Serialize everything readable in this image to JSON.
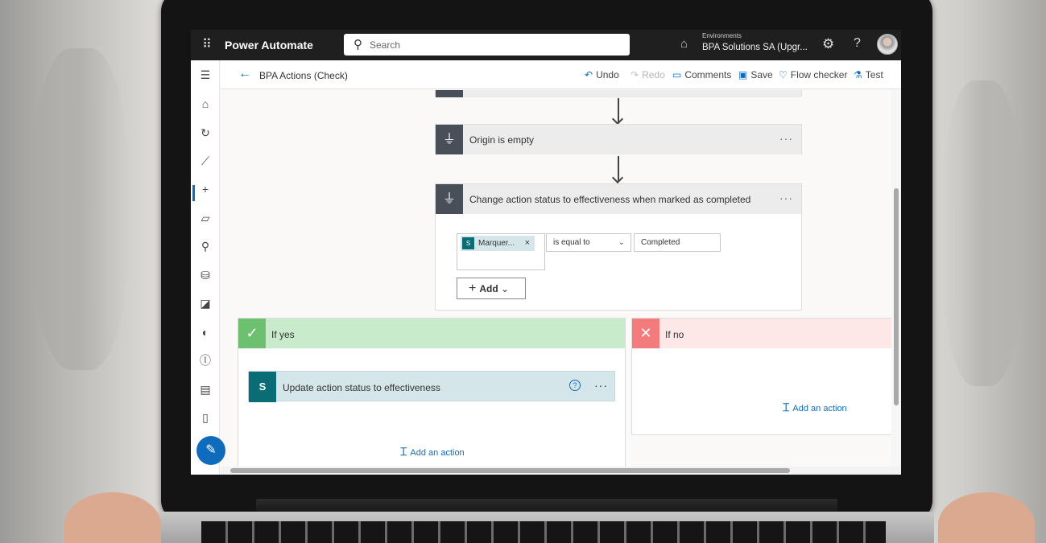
{
  "app": {
    "name": "Power Automate",
    "waffle_icon": "⠿"
  },
  "search": {
    "placeholder": "Search"
  },
  "environment": {
    "label": "Environments",
    "value": "BPA Solutions SA (Upgr..."
  },
  "header_icons": {
    "settings": "⚙",
    "help": "?"
  },
  "flow": {
    "title": "BPA Actions (Check)"
  },
  "commands": {
    "undo": "Undo",
    "redo": "Redo",
    "comments": "Comments",
    "save": "Save",
    "flow_checker": "Flow checker",
    "test": "Test"
  },
  "nav_icons": [
    "☰",
    "⌂",
    "↻",
    "⟋",
    "+",
    "▱",
    "⚲",
    "⛁",
    "◪",
    "◐",
    "ⓛ",
    "▤",
    "▯"
  ],
  "steps": {
    "origin": {
      "title": "Origin is empty"
    },
    "condition": {
      "title": "Change action status to effectiveness when marked as completed",
      "token_label": "Marquer...",
      "token_icon": "S",
      "operator": "is equal to",
      "value": "Completed",
      "add_label": "Add"
    }
  },
  "branches": {
    "yes": {
      "title": "If yes",
      "color": "#c8eccb",
      "icon_color": "#6cc06f",
      "action": {
        "title": "Update action status to effectiveness",
        "icon": "S"
      },
      "add_action": "Add an action"
    },
    "no": {
      "title": "If no",
      "color": "#fde7e7",
      "icon_color": "#f47b7b",
      "add_action": "Add an action"
    }
  },
  "colors": {
    "accent": "#0f6cbd",
    "topbar": "#1f1f1f",
    "sharepoint": "#0a6c74"
  }
}
